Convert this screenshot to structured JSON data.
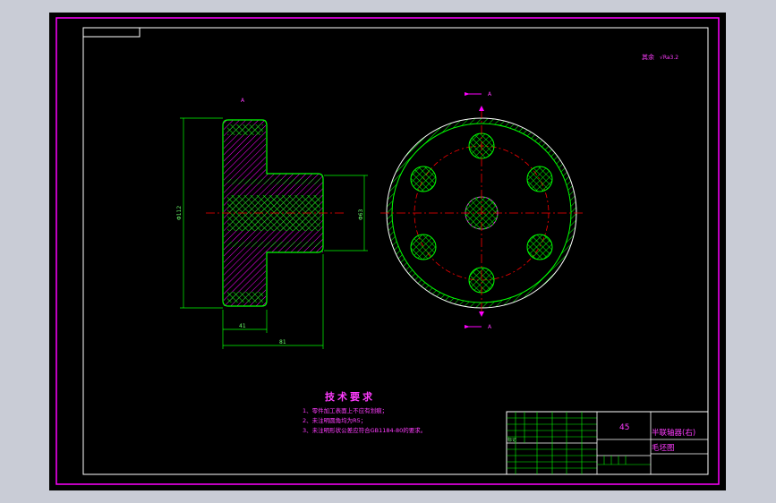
{
  "drawing": {
    "roughness_note": "其余",
    "roughness_symbol": "√Ra3.2",
    "section_marker": "A",
    "section_label_top": "A",
    "section_label_bottom": "A",
    "dim_left_height": "Φ112",
    "dim_hub_height": "Φ63",
    "dim_flange_width": "41",
    "dim_total_width": "81"
  },
  "technical_requirements": {
    "title": "技术要求",
    "items": [
      "1、零件加工表面上不应有划痕；",
      "2、未注明圆角均为R5；",
      "3、未注明形状公差应符合GB1184-80的要求。"
    ]
  },
  "title_block": {
    "material": "45",
    "part_name": "半联轴器(右)",
    "drawing_type": "毛坯图",
    "left_label": "标记"
  },
  "colors": {
    "background": "#000000",
    "frame": "#ff00ff",
    "outline": "#ffffff",
    "part_edges": "#00ff00",
    "hatch": "#ff00ff",
    "centerline": "#ff0000",
    "text_green": "#6dff6d",
    "text_magenta": "#ff3cff"
  }
}
